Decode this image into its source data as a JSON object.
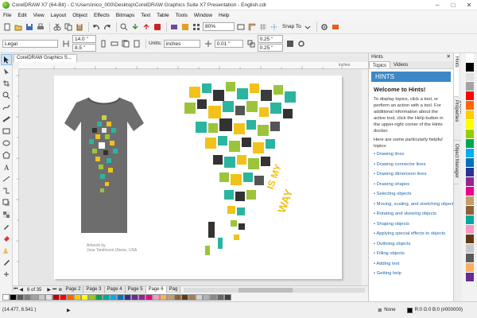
{
  "window": {
    "title": "CorelDRAW X7 (64-Bit) - C:\\Users\\nico_000\\Desktop\\CorelDRAW Graphics Suite X7 Presentation - English.cdr"
  },
  "menu": [
    "File",
    "Edit",
    "View",
    "Layout",
    "Object",
    "Effects",
    "Bitmaps",
    "Text",
    "Table",
    "Tools",
    "Window",
    "Help"
  ],
  "toolbar": {
    "zoom": "80%",
    "snap_to": "Snap To"
  },
  "property_bar": {
    "paper": "Legal",
    "width": "14.0 \"",
    "height": "8.5 \"",
    "units_label": "Units:",
    "units": "inches",
    "nudge": "0.01 \"",
    "dup_x": "0.25 \"",
    "dup_y": "0.25 \""
  },
  "document": {
    "tab_label": "CorelDRAW Graphics S...",
    "ruler_units": "inches",
    "caption_line1": "Artwork by",
    "caption_line2": "Jose Tamlinson Ubeze, USA"
  },
  "pages": {
    "current": "6",
    "total": "35",
    "counter": "6 of 35",
    "tabs": [
      "Page 2",
      "Page 3",
      "Page 4",
      "Page 5",
      "Page 6",
      "Pag"
    ],
    "active_index": 4
  },
  "palette_bottom": [
    "#ffffff",
    "#000000",
    "#5b5b5b",
    "#7f7f7f",
    "#a3a3a3",
    "#c8c8c8",
    "#e0e0e0",
    "#c00000",
    "#ff0000",
    "#ff6600",
    "#ffcc00",
    "#ffff00",
    "#99cc00",
    "#00a651",
    "#00a99d",
    "#00aeef",
    "#0072bc",
    "#2e3192",
    "#662d91",
    "#92278f",
    "#ec008c",
    "#f49ac2",
    "#fbaf5d",
    "#c69c6d",
    "#8c6239",
    "#603913",
    "#a67c52",
    "#d3d3d3",
    "#b2b2b2",
    "#898989",
    "#666666",
    "#404040"
  ],
  "palette_right": [
    "#ffffff",
    "#000000",
    "#e0e0e0",
    "#a3a3a3",
    "#ff0000",
    "#ff6600",
    "#ffcc00",
    "#ffff00",
    "#99cc00",
    "#00a651",
    "#00aeef",
    "#0072bc",
    "#2e3192",
    "#92278f",
    "#ec008c",
    "#c69c6d",
    "#8c6239",
    "#00a99d",
    "#f49ac2",
    "#603913",
    "#c8c8c8",
    "#5b5b5b",
    "#fbaf5d",
    "#662d91"
  ],
  "status": {
    "coords": "(14.477, 8.541 )",
    "fill_label": "None",
    "color_info": "R:0 G:0 B:0 (#000000)"
  },
  "hints_docker": {
    "title": "Hints",
    "tabs": [
      "Topics",
      "Videos"
    ],
    "banner": "HINTS",
    "heading": "Welcome to Hints!",
    "para1": "To display topics, click a tool, or perform an action with a tool. For additional information about the active tool, click the Help button in the upper-right corner of the Hints docker.",
    "para2": "Here are some particularly helpful topics:",
    "links": [
      "Drawing lines",
      "Drawing connector lines",
      "Drawing dimension lines",
      "Drawing shapes",
      "Selecting objects",
      "Moving, scaling, and stretching objects",
      "Rotating and skewing objects",
      "Shaping objects",
      "Applying special effects to objects",
      "Outlining objects",
      "Filling objects",
      "Adding text",
      "Getting help"
    ]
  },
  "docker_tabs": [
    "Hints",
    "Object Properties",
    "Object Manager"
  ],
  "colors": {
    "accent": "#3c88c7",
    "link": "#2167a8"
  }
}
